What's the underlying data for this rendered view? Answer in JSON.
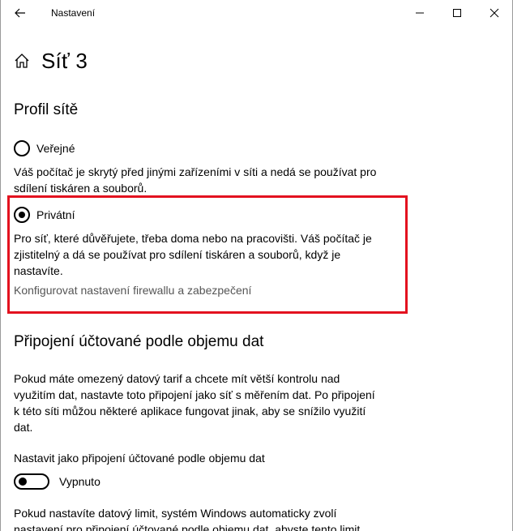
{
  "window": {
    "title": "Nastavení"
  },
  "header": {
    "title": "Síť 3"
  },
  "profile": {
    "heading": "Profil sítě",
    "public_label": "Veřejné",
    "public_selected": false,
    "public_desc_line1": "Váš počítač je skrytý před jinými zařízeními v síti a nedá se používat pro",
    "public_desc_line2": "sdílení tiskáren a souborů.",
    "private_label": "Privátní",
    "private_selected": true,
    "private_desc_line1": "Pro síť, které důvěřujete, třeba doma nebo na pracovišti. Váš počítač je",
    "private_desc_line2": "zjistitelný a dá se používat pro sdílení tiskáren a souborů, když je",
    "private_desc_line3": "nastavíte.",
    "firewall_link": "Konfigurovat nastavení firewallu a zabezpečení"
  },
  "metered": {
    "heading": "Připojení účtované podle objemu dat",
    "desc_line1": "Pokud máte omezený datový tarif a chcete mít větší kontrolu nad",
    "desc_line2": "využitím dat, nastavte toto připojení jako síť s měřením dat. Po připojení",
    "desc_line3": "k této síti můžou některé aplikace fungovat jinak, aby se snížilo využití",
    "desc_line4": "dat.",
    "toggle_caption": "Nastavit jako připojení účtované podle objemu dat",
    "toggle_state": "Vypnuto",
    "toggle_on": false,
    "limit_line1": "Pokud nastavíte datový limit, systém Windows automaticky zvolí",
    "limit_line2": "nastavení pro připojení účtované podle objemu dat, abyste tento limit"
  },
  "colors": {
    "highlight": "#e3121f",
    "link": "#555555"
  },
  "icons": {
    "back": "back-arrow-icon",
    "home": "home-icon",
    "minimize": "minimize-icon",
    "maximize": "maximize-icon",
    "close": "close-icon"
  }
}
